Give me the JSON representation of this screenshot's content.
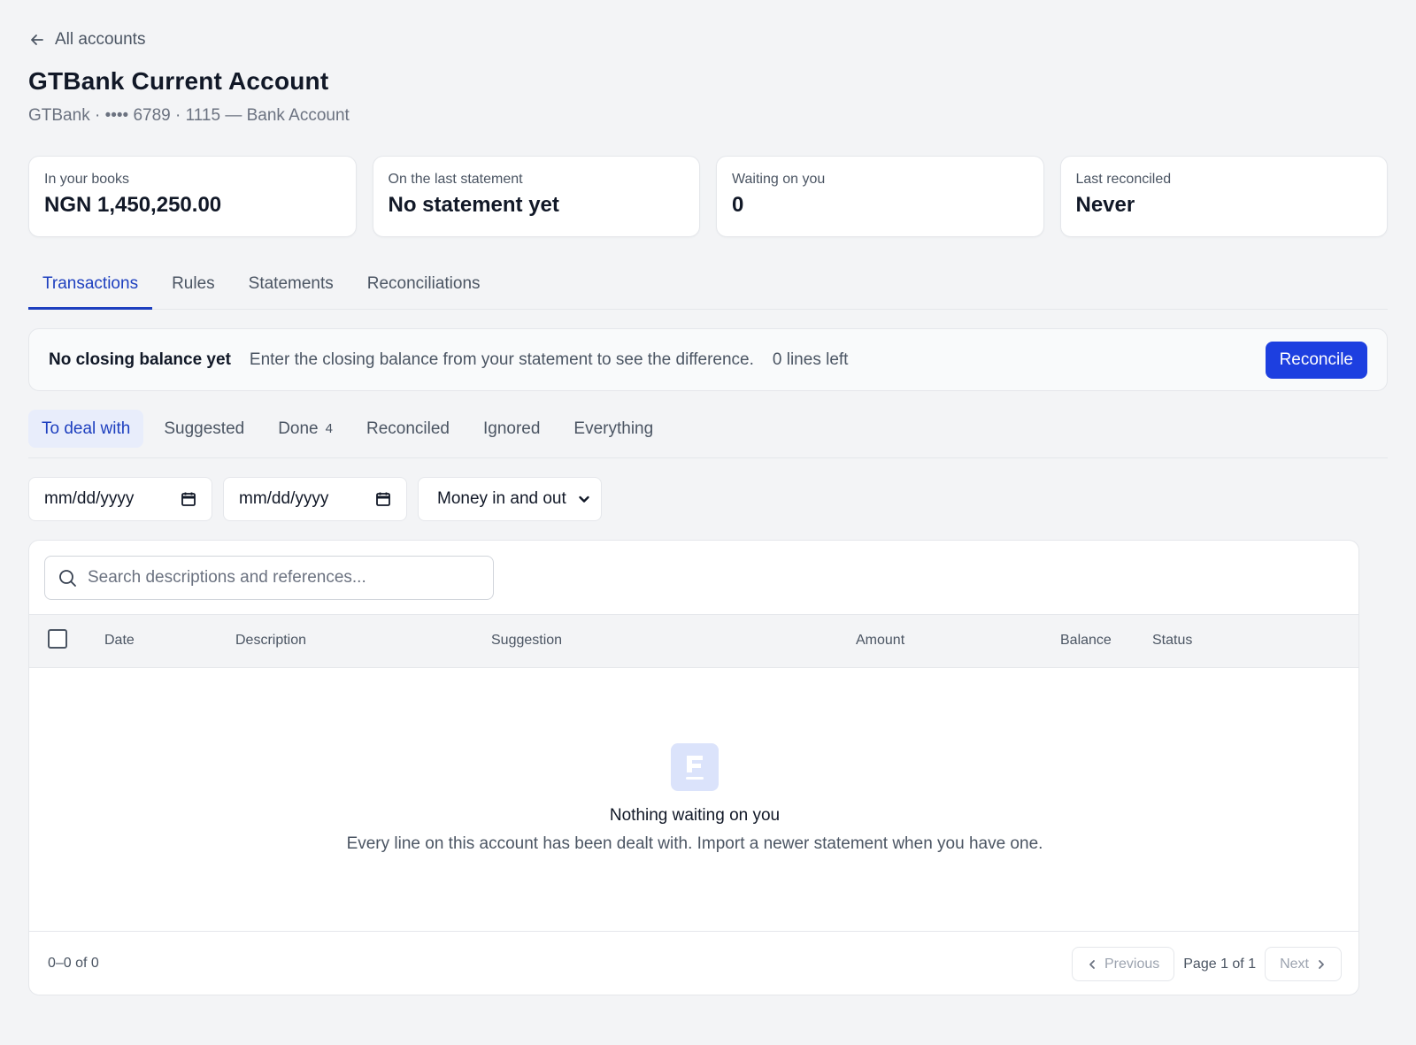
{
  "back_link": {
    "label": "All accounts",
    "icon": "arrow-left-icon"
  },
  "account": {
    "title": "GTBank Current Account",
    "subtitle": "GTBank · •••• 6789 · 1115 — Bank Account"
  },
  "stats": [
    {
      "label": "In your books",
      "value": "NGN 1,450,250.00"
    },
    {
      "label": "On the last statement",
      "value": "No statement yet"
    },
    {
      "label": "Waiting on you",
      "value": "0"
    },
    {
      "label": "Last reconciled",
      "value": "Never"
    }
  ],
  "tabs": [
    {
      "label": "Transactions",
      "active": true
    },
    {
      "label": "Rules",
      "active": false
    },
    {
      "label": "Statements",
      "active": false
    },
    {
      "label": "Reconciliations",
      "active": false
    }
  ],
  "banner": {
    "title": "No closing balance yet",
    "text": "Enter the closing balance from your statement to see the difference.",
    "lines_left": "0 lines left",
    "button": "Reconcile"
  },
  "subtabs": [
    {
      "label": "To deal with",
      "count": "",
      "active": true
    },
    {
      "label": "Suggested",
      "count": "",
      "active": false
    },
    {
      "label": "Done",
      "count": "4",
      "active": false
    },
    {
      "label": "Reconciled",
      "count": "",
      "active": false
    },
    {
      "label": "Ignored",
      "count": "",
      "active": false
    },
    {
      "label": "Everything",
      "count": "",
      "active": false
    }
  ],
  "filters": {
    "date_from": "mm/dd/yyyy",
    "date_to": "mm/dd/yyyy",
    "direction": "Money in and out"
  },
  "search": {
    "placeholder": "Search descriptions and references..."
  },
  "table": {
    "columns": [
      "Date",
      "Description",
      "Suggestion",
      "Amount",
      "Balance",
      "Status"
    ],
    "rows": []
  },
  "empty_state": {
    "title": "Nothing waiting on you",
    "text": "Every line on this account has been dealt with. Import a newer statement when you have one."
  },
  "pagination": {
    "range": "0–0 of 0",
    "previous": "Previous",
    "page": "Page 1 of 1",
    "next": "Next"
  },
  "colors": {
    "accent": "#1d3fe0",
    "accent_text": "#1d3fbf",
    "active_subtab_bg": "#e8edfb",
    "page_bg": "#f3f4f6"
  }
}
